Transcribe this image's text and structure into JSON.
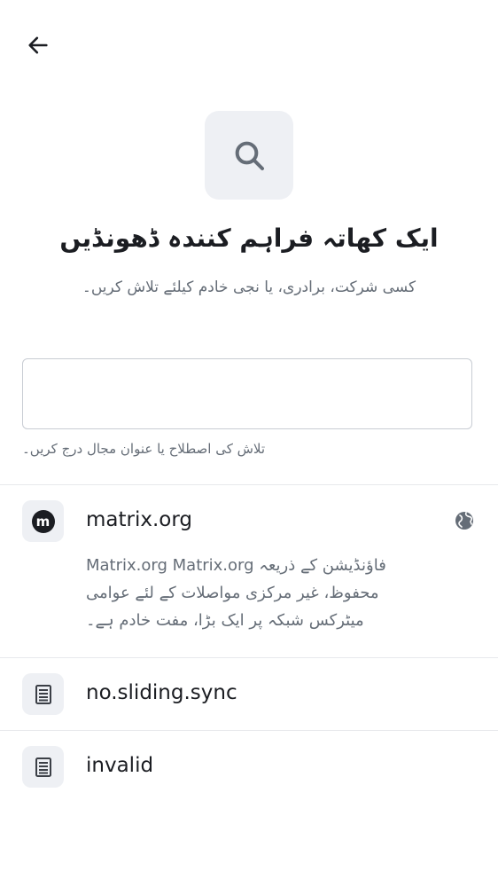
{
  "header": {
    "back_icon": "arrow-left-icon"
  },
  "hero": {
    "icon": "search-icon",
    "title": "ایک کھاتہ فراہم کنندہ ڈھونڈیں",
    "subtitle": "کسی شرکت، برادری، یا نجی خادم کیلئے تلاش کریں۔"
  },
  "search": {
    "value": "",
    "placeholder": "",
    "helper": "تلاش کی اصطلاح یا عنوان مجال درج کریں۔"
  },
  "providers": [
    {
      "name": "matrix.org",
      "icon": "matrix-logo-icon",
      "badge_letter": "m",
      "trailing_icon": "globe-icon",
      "description_lines": [
        "فاؤنڈیشن کے ذریعہ Matrix.org Matrix.org",
        "محفوظ، غیر مرکزی مواصلات کے لئے عوامی",
        "میٹرکس شبکہ پر ایک بڑا، مفت خادم ہے۔"
      ]
    },
    {
      "name": "no.sliding.sync",
      "icon": "server-icon"
    },
    {
      "name": "invalid",
      "icon": "server-icon"
    }
  ],
  "colors": {
    "text_primary": "#1b1d22",
    "text_secondary": "#656d77",
    "icon_background": "#eef0f4",
    "divider": "#e7e9ec"
  }
}
